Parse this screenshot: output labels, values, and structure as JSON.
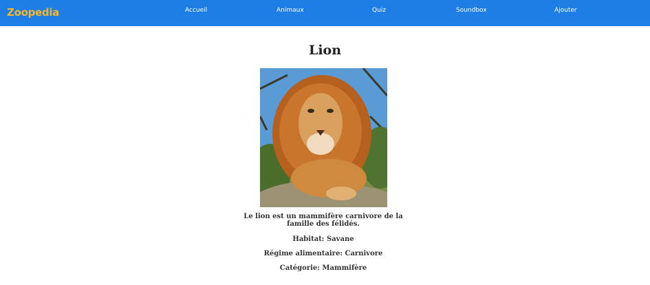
{
  "header": {
    "logo": "Zoopedia",
    "nav": [
      {
        "label": "Accueil"
      },
      {
        "label": "Animaux"
      },
      {
        "label": "Quiz"
      },
      {
        "label": "Soundbox"
      },
      {
        "label": "Ajouter"
      }
    ],
    "colors": {
      "bar": "#1f7de6",
      "logo": "#f5b72a"
    }
  },
  "animal": {
    "name": "Lion",
    "image_icon": "lion-photo",
    "description": "Le lion est un mammifère carnivore de la famille des félidés.",
    "habitat": "Habitat: Savane",
    "regime": "Régime alimentaire: Carnivore",
    "categorie": "Catégorie: Mammifère"
  }
}
